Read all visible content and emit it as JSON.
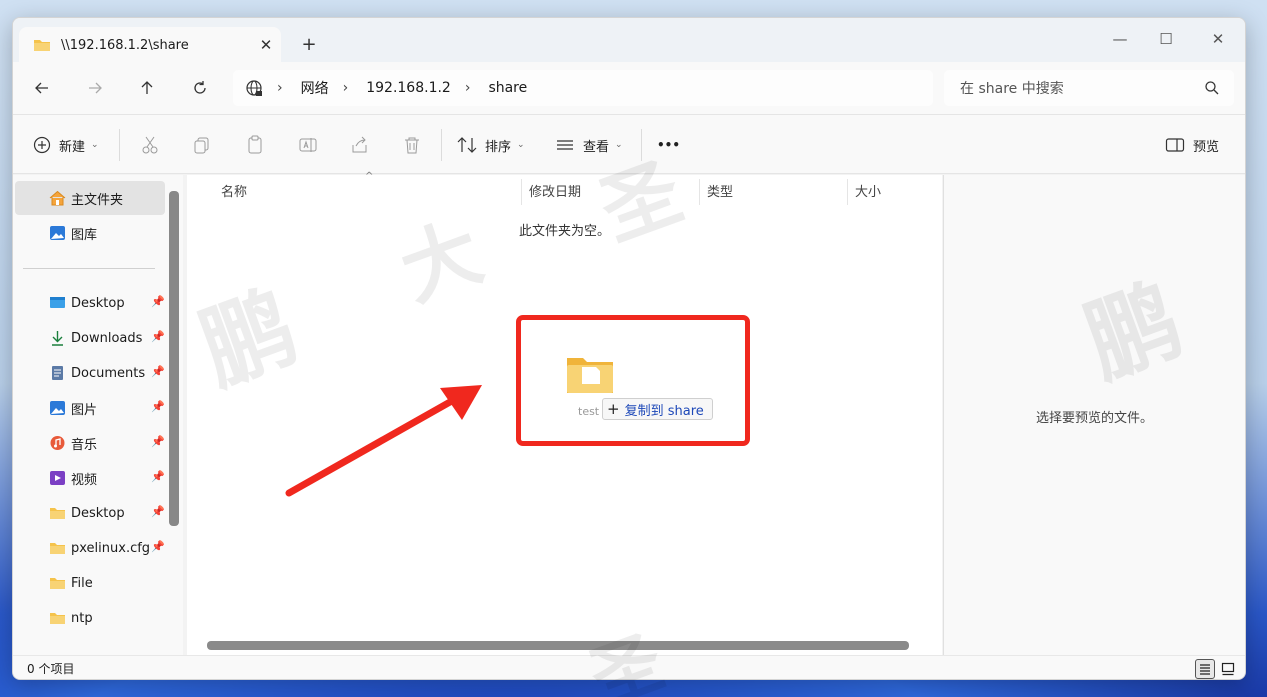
{
  "window": {
    "tab_title": "\\\\192.168.1.2\\share",
    "tab_close": "✕",
    "new_tab": "+",
    "min": "—",
    "max": "☐",
    "close": "✕"
  },
  "address": {
    "crumbs": [
      "网络",
      "192.168.1.2",
      "share"
    ],
    "search_placeholder": "在 share 中搜索"
  },
  "toolbar": {
    "new_label": "新建",
    "sort_label": "排序",
    "view_label": "查看",
    "more_label": "•••",
    "preview_label": "预览"
  },
  "sidebar": {
    "items": [
      {
        "label": "主文件夹",
        "icon": "home-icon",
        "pinned": false
      },
      {
        "label": "图库",
        "icon": "gallery-icon",
        "pinned": false
      },
      {
        "label": "Desktop",
        "icon": "desktop-icon",
        "pinned": true
      },
      {
        "label": "Downloads",
        "icon": "download-icon",
        "pinned": true
      },
      {
        "label": "Documents",
        "icon": "documents-icon",
        "pinned": true
      },
      {
        "label": "图片",
        "icon": "pictures-icon",
        "pinned": true
      },
      {
        "label": "音乐",
        "icon": "music-icon",
        "pinned": true
      },
      {
        "label": "视频",
        "icon": "video-icon",
        "pinned": true
      },
      {
        "label": "Desktop",
        "icon": "folder-icon",
        "pinned": true
      },
      {
        "label": "pxelinux.cfg",
        "icon": "folder-icon",
        "pinned": true
      },
      {
        "label": "File",
        "icon": "folder-icon",
        "pinned": false
      },
      {
        "label": "ntp",
        "icon": "folder-icon",
        "pinned": false
      }
    ]
  },
  "columns": {
    "name": "名称",
    "date": "修改日期",
    "type": "类型",
    "size": "大小"
  },
  "content": {
    "empty_message": "此文件夹为空。"
  },
  "preview": {
    "message": "选择要预览的文件。"
  },
  "status": {
    "item_count": "0 个项目"
  },
  "drag": {
    "folder_name": "test",
    "tooltip": "复制到 share"
  },
  "watermark": {
    "chars": [
      "鹏",
      "大",
      "圣",
      "鹏",
      "圣"
    ]
  },
  "colors": {
    "highlight": "#f0281e",
    "link": "#1d48b8",
    "folder": "#f5c34b"
  }
}
